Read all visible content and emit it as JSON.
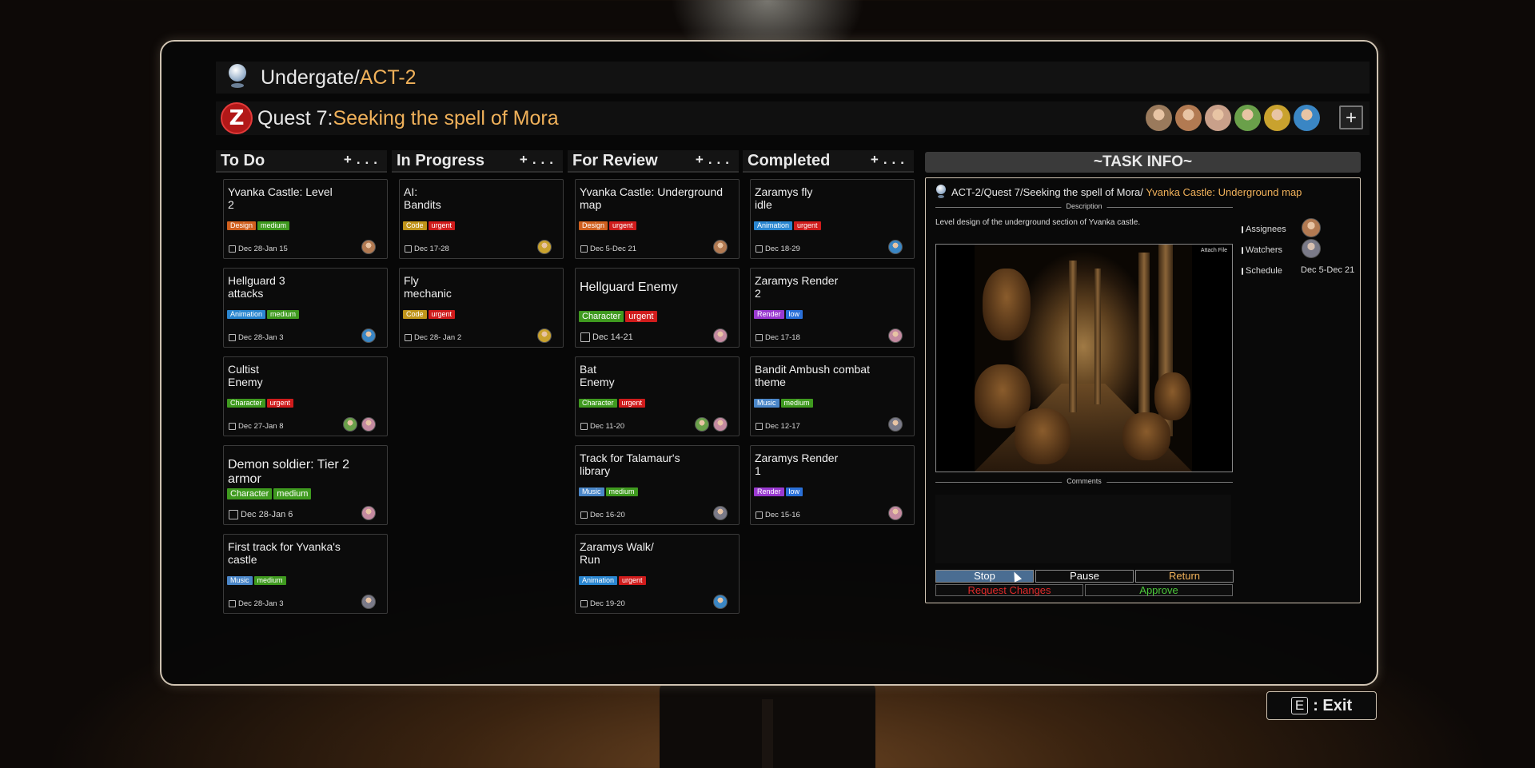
{
  "breadcrumb": {
    "project": "Undergate/",
    "act": "ACT-2"
  },
  "quest": {
    "logo_letter": "Z",
    "prefix": "Quest 7:",
    "name": "Seeking the spell of Mora"
  },
  "team_avatar_colors": [
    "#9a7a5c",
    "#b27a52",
    "#c9a08a",
    "#6aa04a",
    "#c9a22e",
    "#3a86c4"
  ],
  "add_button": "+",
  "columns": [
    {
      "name": "To Do",
      "add": "+",
      "more": "...",
      "cards": [
        {
          "title": "Yvanka Castle: Level\n2",
          "tags": [
            {
              "label": "Design",
              "color": "#d0601e"
            },
            {
              "label": "medium",
              "color": "#3f9a1f"
            }
          ],
          "date": "Dec 28-Jan 15",
          "avatars": [
            "#b27a52"
          ]
        },
        {
          "title": "Hellguard 3\nattacks",
          "tags": [
            {
              "label": "Animation",
              "color": "#2a86d0"
            },
            {
              "label": "medium",
              "color": "#3f9a1f"
            }
          ],
          "date": "Dec 28-Jan 3",
          "avatars": [
            "#3a86c4"
          ]
        },
        {
          "title": "Cultist\nEnemy",
          "tags": [
            {
              "label": "Character",
              "color": "#3f9a1f"
            },
            {
              "label": "urgent",
              "color": "#d01c1c"
            }
          ],
          "date": "Dec 27-Jan 8",
          "avatars": [
            "#6aa04a",
            "#c48aa0"
          ]
        },
        {
          "title": "Demon soldier: Tier 2 armor",
          "big": true,
          "tags": [
            {
              "label": "Character",
              "color": "#3f9a1f"
            },
            {
              "label": "medium",
              "color": "#3f9a1f"
            }
          ],
          "date": "Dec 28-Jan 6",
          "avatars": [
            "#c48aa0"
          ]
        },
        {
          "title": "First track for Yvanka's\ncastle",
          "tags": [
            {
              "label": "Music",
              "color": "#4a86c8"
            },
            {
              "label": "medium",
              "color": "#3f9a1f"
            }
          ],
          "date": "Dec 28-Jan 3",
          "avatars": [
            "#7a7a88"
          ]
        }
      ]
    },
    {
      "name": "In Progress",
      "add": "+",
      "more": "...",
      "cards": [
        {
          "title": "AI:\nBandits",
          "tags": [
            {
              "label": "Code",
              "color": "#c0941a"
            },
            {
              "label": "urgent",
              "color": "#d01c1c"
            }
          ],
          "date": "Dec 17-28",
          "avatars": [
            "#c9a22e"
          ]
        },
        {
          "title": "Fly\nmechanic",
          "tags": [
            {
              "label": "Code",
              "color": "#c0941a"
            },
            {
              "label": "urgent",
              "color": "#d01c1c"
            }
          ],
          "date": "Dec 28- Jan 2",
          "avatars": [
            "#c9a22e"
          ]
        }
      ]
    },
    {
      "name": "For Review",
      "add": "+",
      "more": "...",
      "cards": [
        {
          "title": "Yvanka Castle: Underground\nmap",
          "tags": [
            {
              "label": "Design",
              "color": "#d0601e"
            },
            {
              "label": "urgent",
              "color": "#d01c1c"
            }
          ],
          "date": "Dec 5-Dec 21",
          "avatars": [
            "#b27a52"
          ]
        },
        {
          "title": "Hellguard Enemy",
          "big": true,
          "tags": [
            {
              "label": "Character",
              "color": "#3f9a1f"
            },
            {
              "label": "urgent",
              "color": "#d01c1c"
            }
          ],
          "date": "Dec 14-21",
          "avatars": [
            "#c48aa0"
          ]
        },
        {
          "title": "Bat\nEnemy",
          "tags": [
            {
              "label": "Character",
              "color": "#3f9a1f"
            },
            {
              "label": "urgent",
              "color": "#d01c1c"
            }
          ],
          "date": "Dec 11-20",
          "avatars": [
            "#6aa04a",
            "#c48aa0"
          ]
        },
        {
          "title": "Track for Talamaur's\nlibrary",
          "tags": [
            {
              "label": "Music",
              "color": "#4a86c8"
            },
            {
              "label": "medium",
              "color": "#3f9a1f"
            }
          ],
          "date": "Dec 16-20",
          "avatars": [
            "#7a7a88"
          ]
        },
        {
          "title": "Zaramys Walk/\nRun",
          "tags": [
            {
              "label": "Animation",
              "color": "#2a86d0"
            },
            {
              "label": "urgent",
              "color": "#d01c1c"
            }
          ],
          "date": "Dec 19-20",
          "avatars": [
            "#3a86c4"
          ]
        }
      ]
    },
    {
      "name": "Completed",
      "add": "+",
      "more": "...",
      "cards": [
        {
          "title": "Zaramys fly\nidle",
          "tags": [
            {
              "label": "Animation",
              "color": "#2a86d0"
            },
            {
              "label": "urgent",
              "color": "#d01c1c"
            }
          ],
          "date": "Dec 18-29",
          "avatars": [
            "#3a86c4"
          ]
        },
        {
          "title": "Zaramys Render\n2",
          "tags": [
            {
              "label": "Render",
              "color": "#9a3ad0"
            },
            {
              "label": "low",
              "color": "#2a70d8"
            }
          ],
          "date": "Dec 17-18",
          "avatars": [
            "#c48aa0"
          ]
        },
        {
          "title": "Bandit Ambush combat\ntheme",
          "tags": [
            {
              "label": "Music",
              "color": "#4a86c8"
            },
            {
              "label": "medium",
              "color": "#3f9a1f"
            }
          ],
          "date": "Dec 12-17",
          "avatars": [
            "#7a7a88"
          ]
        },
        {
          "title": "Zaramys Render\n1",
          "tags": [
            {
              "label": "Render",
              "color": "#9a3ad0"
            },
            {
              "label": "low",
              "color": "#2a70d8"
            }
          ],
          "date": "Dec 15-16",
          "avatars": [
            "#c48aa0"
          ]
        }
      ]
    }
  ],
  "task_info": {
    "header": "~TASK INFO~",
    "path_prefix": "ACT-2/Quest 7/Seeking the spell of Mora/",
    "path_task": " Yvanka Castle: Underground map",
    "description_label": "Description",
    "description": "Level design of the underground section of Yvanka castle.",
    "image_actions": "Attach File",
    "comments_label": "Comments",
    "assignees_label": "Assignees",
    "watchers_label": "Watchers",
    "schedule_label": "Schedule",
    "schedule_value": "Dec 5-Dec 21",
    "assignee_color": "#b27a52",
    "watcher_color": "#7a7a88",
    "buttons": {
      "stop": "Stop",
      "pause": "Pause",
      "return": "Return",
      "request_changes": "Request Changes",
      "approve": "Approve"
    }
  },
  "exit": {
    "key": "E",
    "label": ": Exit"
  }
}
